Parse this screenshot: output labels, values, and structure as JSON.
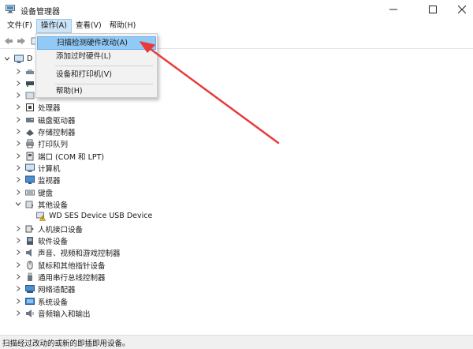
{
  "window": {
    "title": "设备管理器"
  },
  "menubar": {
    "items": [
      {
        "label": "文件(F)",
        "active": false
      },
      {
        "label": "操作(A)",
        "active": true
      },
      {
        "label": "查看(V)",
        "active": false
      },
      {
        "label": "帮助(H)",
        "active": false
      }
    ]
  },
  "dropdown": {
    "items": [
      {
        "label": "扫描检测硬件改动(A)",
        "highlighted": true
      },
      {
        "label": "添加过时硬件(L)",
        "highlighted": false
      },
      {
        "label": "设备和打印机(V)",
        "highlighted": false
      },
      {
        "label": "帮助(H)",
        "highlighted": false
      }
    ]
  },
  "tree": {
    "root_fragment": "D",
    "categories": [
      {
        "label": "",
        "icon": "audio-input-icon"
      },
      {
        "label": "",
        "icon": "network-icon"
      },
      {
        "label": "",
        "icon": "disk-icon"
      },
      {
        "label": "处理器",
        "icon": "processor-icon"
      },
      {
        "label": "磁盘驱动器",
        "icon": "disk-drive-icon"
      },
      {
        "label": "存储控制器",
        "icon": "storage-controller-icon"
      },
      {
        "label": "打印队列",
        "icon": "printer-icon"
      },
      {
        "label": "端口 (COM 和 LPT)",
        "icon": "port-icon"
      },
      {
        "label": "计算机",
        "icon": "computer-icon"
      },
      {
        "label": "监视器",
        "icon": "monitor-icon"
      },
      {
        "label": "键盘",
        "icon": "keyboard-icon"
      },
      {
        "label": "其他设备",
        "icon": "other-devices-icon"
      },
      {
        "label": "WD SES Device USB Device",
        "icon": "warning-device-icon"
      },
      {
        "label": "人机接口设备",
        "icon": "hid-icon"
      },
      {
        "label": "软件设备",
        "icon": "software-device-icon"
      },
      {
        "label": "声音、视频和游戏控制器",
        "icon": "sound-icon"
      },
      {
        "label": "鼠标和其他指针设备",
        "icon": "mouse-icon"
      },
      {
        "label": "通用串行总线控制器",
        "icon": "usb-icon"
      },
      {
        "label": "网络适配器",
        "icon": "network-adapter-icon"
      },
      {
        "label": "系统设备",
        "icon": "system-device-icon"
      },
      {
        "label": "音频输入和输出",
        "icon": "audio-io-icon"
      }
    ]
  },
  "statusbar": {
    "text": "扫描经过改动的或新的即插即用设备。"
  },
  "colors": {
    "menu_active_bg": "#cce4f7",
    "dropdown_highlight": "#91c9f7",
    "arrow": "#e83a3a"
  }
}
